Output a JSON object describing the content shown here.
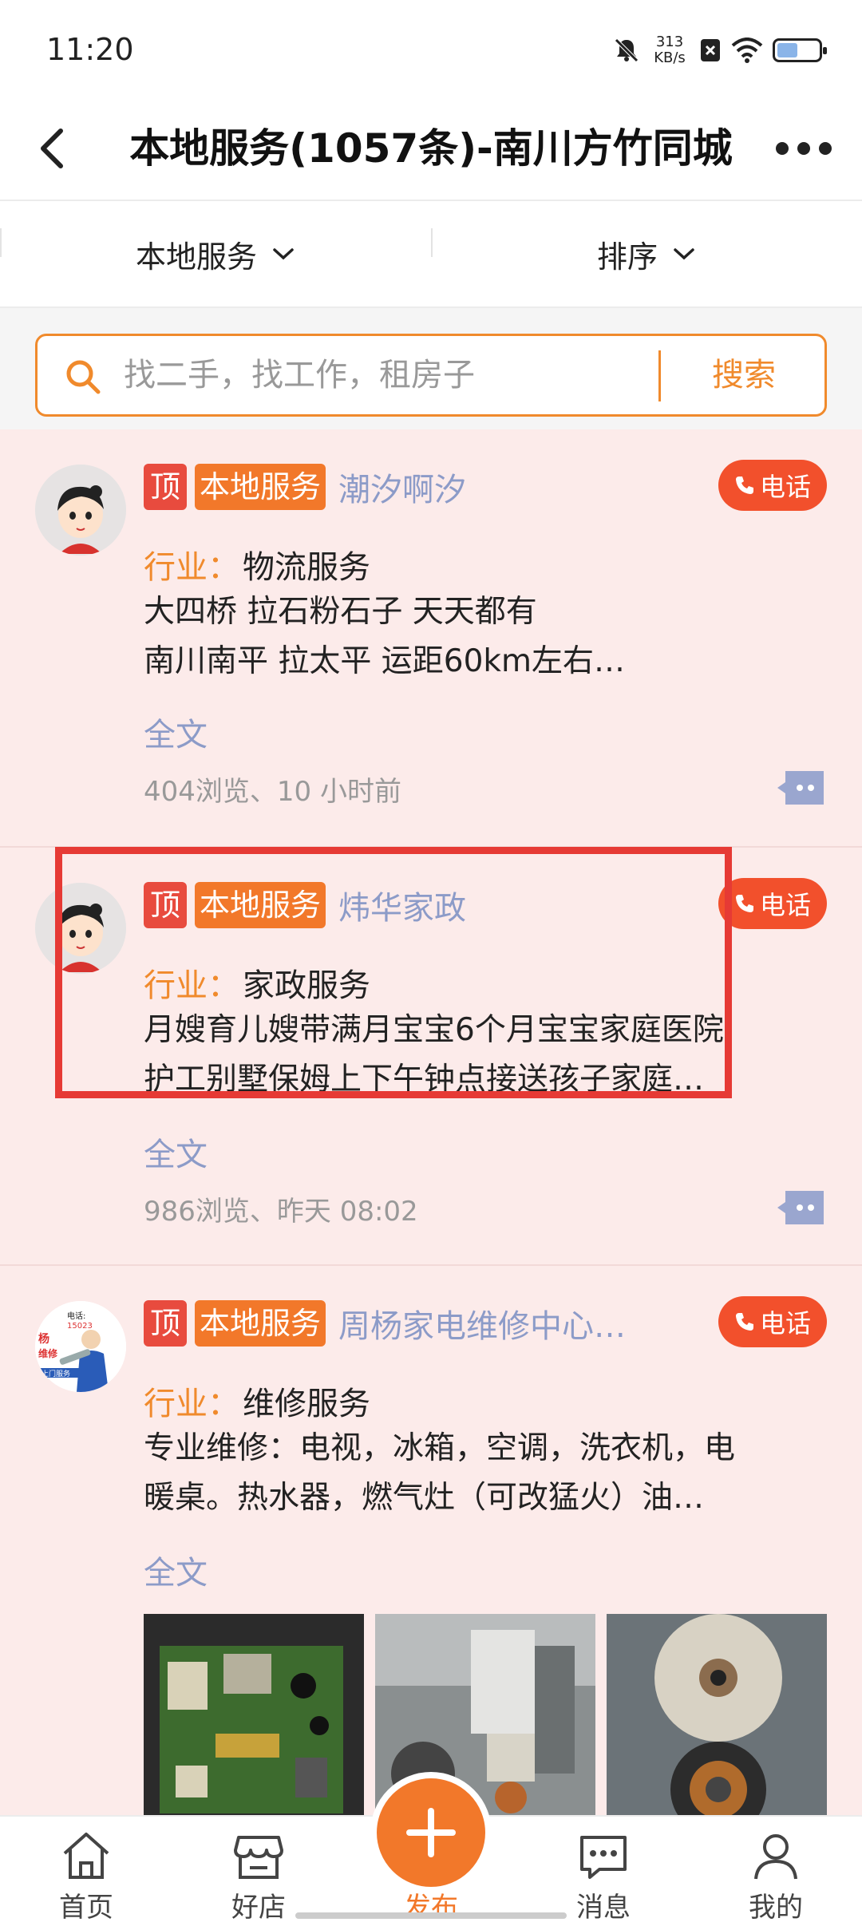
{
  "status_bar": {
    "time": "11:20",
    "net_speed_value": "313",
    "net_speed_unit": "KB/s",
    "battery_level": 0.5
  },
  "header": {
    "title": "本地服务(1057条)-南川方竹同城"
  },
  "filters": [
    {
      "label": "本地服务"
    },
    {
      "label": "排序"
    }
  ],
  "search": {
    "placeholder": "找二手，找工作，租房子",
    "button_label": "搜索"
  },
  "listings": [
    {
      "top_tag": "顶",
      "category_tag": "本地服务",
      "poster": "潮汐啊汐",
      "call_label": "电话",
      "industry_label": "行业：",
      "industry": "物流服务",
      "desc_lines": [
        "大四桥 拉石粉石子 天天都有",
        "南川南平 拉太平 运距60km左右…"
      ],
      "full_text_label": "全文",
      "meta": "404浏览、10 小时前"
    },
    {
      "top_tag": "顶",
      "category_tag": "本地服务",
      "poster": "炜华家政",
      "call_label": "电话",
      "industry_label": "行业：",
      "industry": "家政服务",
      "desc_lines": [
        "月嫂育儿嫂带满月宝宝6个月宝宝家庭医院",
        "护工别墅保姆上下午钟点接送孩子家庭…"
      ],
      "full_text_label": "全文",
      "meta": "986浏览、昨天 08:02"
    },
    {
      "top_tag": "顶",
      "category_tag": "本地服务",
      "poster": "周杨家电维修中心…",
      "call_label": "电话",
      "industry_label": "行业：",
      "industry": "维修服务",
      "desc_lines": [
        "专业维修：电视，冰箱，空调，洗衣机，电",
        "暖桌。热水器，燃气灶（可改猛火）油…"
      ],
      "full_text_label": "全文",
      "avatar_text": [
        "电话:",
        "15023",
        "杨",
        "维修",
        "上门服务"
      ]
    }
  ],
  "bottom_nav": [
    {
      "label": "首页",
      "icon": "home-icon"
    },
    {
      "label": "好店",
      "icon": "shop-icon"
    },
    {
      "label": "发布",
      "icon": "plus-icon"
    },
    {
      "label": "消息",
      "icon": "message-icon"
    },
    {
      "label": "我的",
      "icon": "user-icon"
    }
  ],
  "colors": {
    "accent": "#f2782a",
    "top_tag": "#e84b3e",
    "call": "#f2502c",
    "highlight": "#e63a35",
    "list_bg": "#fcebea"
  }
}
